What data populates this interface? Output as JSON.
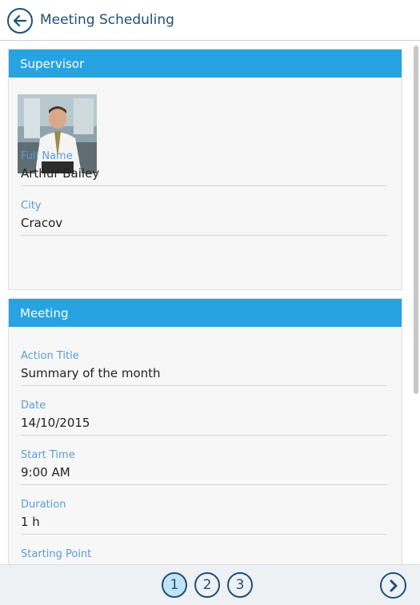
{
  "header": {
    "title": "Meeting Scheduling",
    "back_icon": "arrow-left-icon"
  },
  "supervisor": {
    "title": "Supervisor",
    "photo": "supervisor-photo",
    "fields": [
      {
        "label": "Full Name",
        "value": "Arthur Bailey"
      },
      {
        "label": "City",
        "value": "Cracov"
      }
    ]
  },
  "meeting": {
    "title": "Meeting",
    "fields": [
      {
        "label": "Action Title",
        "value": "Summary of the month"
      },
      {
        "label": "Date",
        "value": "14/10/2015"
      },
      {
        "label": "Start Time",
        "value": "9:00 AM"
      },
      {
        "label": "Duration",
        "value": "1 h"
      },
      {
        "label": "Starting Point",
        "value": ""
      }
    ]
  },
  "pager": {
    "pages": [
      "1",
      "2",
      "3"
    ],
    "active_page": "1",
    "next_icon": "chevron-right-icon"
  },
  "colors": {
    "accent": "#27a3e2",
    "dark_blue": "#1f4e79",
    "label": "#5b9bd5"
  }
}
